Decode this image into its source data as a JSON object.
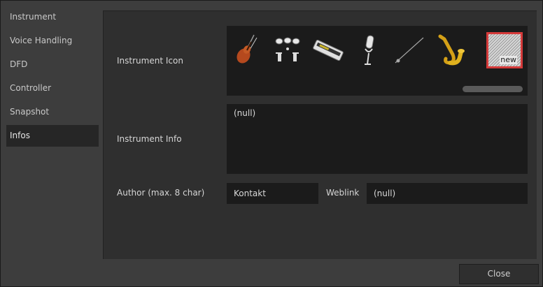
{
  "sidebar": {
    "items": [
      {
        "label": "Instrument"
      },
      {
        "label": "Voice Handling"
      },
      {
        "label": "DFD"
      },
      {
        "label": "Controller"
      },
      {
        "label": "Snapshot"
      },
      {
        "label": "Infos",
        "active": true
      }
    ]
  },
  "form": {
    "instrument_icon_label": "Instrument Icon",
    "icons": [
      "violin-icon",
      "drums-icon",
      "keyboard-icon",
      "microphone-icon",
      "clarinet-icon",
      "saxophone-icon",
      "new-icon"
    ],
    "selected_icon": "new-icon",
    "new_icon_text": "new",
    "instrument_info_label": "Instrument Info",
    "instrument_info_value": "(null)",
    "author_label": "Author (max. 8 char)",
    "author_value": "Kontakt",
    "weblink_label": "Weblink",
    "weblink_value": "(null)"
  },
  "footer": {
    "close_label": "Close"
  },
  "colors": {
    "selection_border": "#d53a3a",
    "active_item_bg": "#262626",
    "field_bg": "#1b1b1b"
  }
}
